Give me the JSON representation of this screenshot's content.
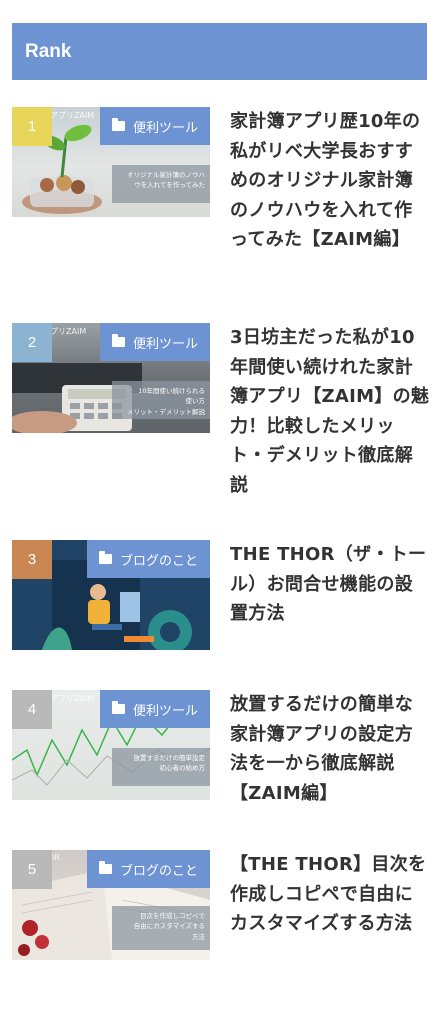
{
  "header": {
    "title": "Rank"
  },
  "colors": {
    "accent": "#6d93d3",
    "rank1": "#e8d65b",
    "rank2": "#8cb4d2",
    "rank3": "#c98552",
    "rank4": "#b9b9b9",
    "rank5": "#b9b9b9"
  },
  "items": [
    {
      "rank": "1",
      "category": "便利ツール",
      "watermark": "簿アプリZAIM",
      "overlay": "オリジナル家計簿のノウハ\nウを入れてを作ってみた",
      "title": "家計簿アプリ歴10年の私がリベ大学長おすすめのオリジナル家計簿のノウハウを入れて作ってみた【ZAIM編】"
    },
    {
      "rank": "2",
      "category": "便利ツール",
      "watermark": "アプリZAIM",
      "overlay": "10年間使い続けられる\n使い方\nメリット・デメリット解説",
      "title": "3日坊主だった私が10年間使い続けれた家計簿アプリ【ZAIM】の魅力！比較したメリット・デメリット徹底解説"
    },
    {
      "rank": "3",
      "category": "ブログのこと",
      "watermark": "",
      "overlay": "",
      "title": "THE THOR（ザ・トール）お問合せ機能の設置方法"
    },
    {
      "rank": "4",
      "category": "便利ツール",
      "watermark": "簿アプリZAIM",
      "overlay": "放置するだけの簡単設定\n初心者の始め方",
      "title": "放置するだけの簡単な家計簿アプリの設定方法を一から徹底解説【ZAIM編】"
    },
    {
      "rank": "5",
      "category": "ブログのこと",
      "watermark": "HOR",
      "overlay": "目次を作成しコピペで\n自由にカスタマイズする\n方法",
      "title": "【THE THOR】目次を作成しコピペで自由にカスタマイズする方法"
    }
  ]
}
